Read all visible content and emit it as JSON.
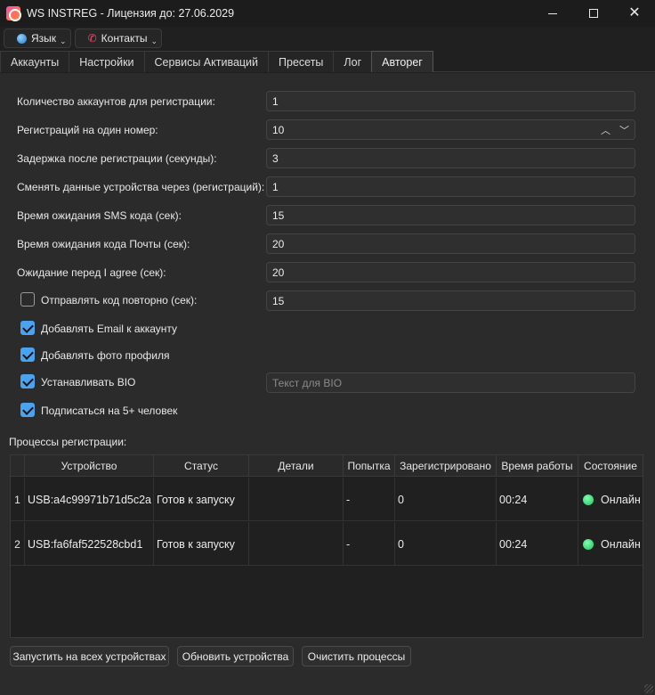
{
  "window": {
    "title": "WS INSTREG - Лицензия до: 27.06.2029"
  },
  "menubar": {
    "language_label": "Язык",
    "contacts_label": "Контакты"
  },
  "tabs": [
    "Аккаунты",
    "Настройки",
    "Сервисы Активаций",
    "Пресеты",
    "Лог",
    "Авторег"
  ],
  "active_tab": "Авторег",
  "form": {
    "accounts_count_label": "Количество аккаунтов для регистрации:",
    "accounts_count_value": "1",
    "regs_per_number_label": "Регистраций на один номер:",
    "regs_per_number_value": "10",
    "delay_after_reg_label": "Задержка после регистрации (секунды):",
    "delay_after_reg_value": "3",
    "change_device_label": "Сменять данные устройства через (регистраций):",
    "change_device_value": "1",
    "sms_wait_label": "Время ожидания SMS кода (сек):",
    "sms_wait_value": "15",
    "mail_wait_label": "Время ожидания кода Почты (сек):",
    "mail_wait_value": "20",
    "i_agree_wait_label": "Ожидание перед I agree (сек):",
    "i_agree_wait_value": "20",
    "resend_code_label": "Отправлять код повторно (сек):",
    "resend_code_value": "15",
    "resend_code_checked": false,
    "add_email_label": "Добавлять Email к аккаунту",
    "add_email_checked": true,
    "add_photo_label": "Добавлять фото профиля",
    "add_photo_checked": true,
    "set_bio_label": "Устанавливать BIO",
    "set_bio_checked": true,
    "bio_placeholder": "Текст для BIO",
    "follow_label": "Подписаться на 5+ человек",
    "follow_checked": true
  },
  "processes": {
    "title": "Процессы регистрации:",
    "columns": [
      "Устройство",
      "Статус",
      "Детали",
      "Попытка",
      "Зарегистрировано",
      "Время работы",
      "Состояние"
    ],
    "rows": [
      {
        "num": "1",
        "device": "USB:a4c99971b71d5c2a",
        "status": "Готов к запуску",
        "details": "",
        "attempt": "-",
        "registered": "0",
        "uptime": "00:24",
        "state": "Онлайн"
      },
      {
        "num": "2",
        "device": "USB:fa6faf522528cbd1",
        "status": "Готов к запуску",
        "details": "",
        "attempt": "-",
        "registered": "0",
        "uptime": "00:24",
        "state": "Онлайн"
      }
    ]
  },
  "buttons": {
    "start_all": "Запустить на всех устройствах",
    "refresh_devices": "Обновить устройства",
    "clear_processes": "Очистить процессы"
  },
  "colors": {
    "accent": "#4aa3f0",
    "online": "#2ecc71",
    "background": "#2b2b2b"
  }
}
